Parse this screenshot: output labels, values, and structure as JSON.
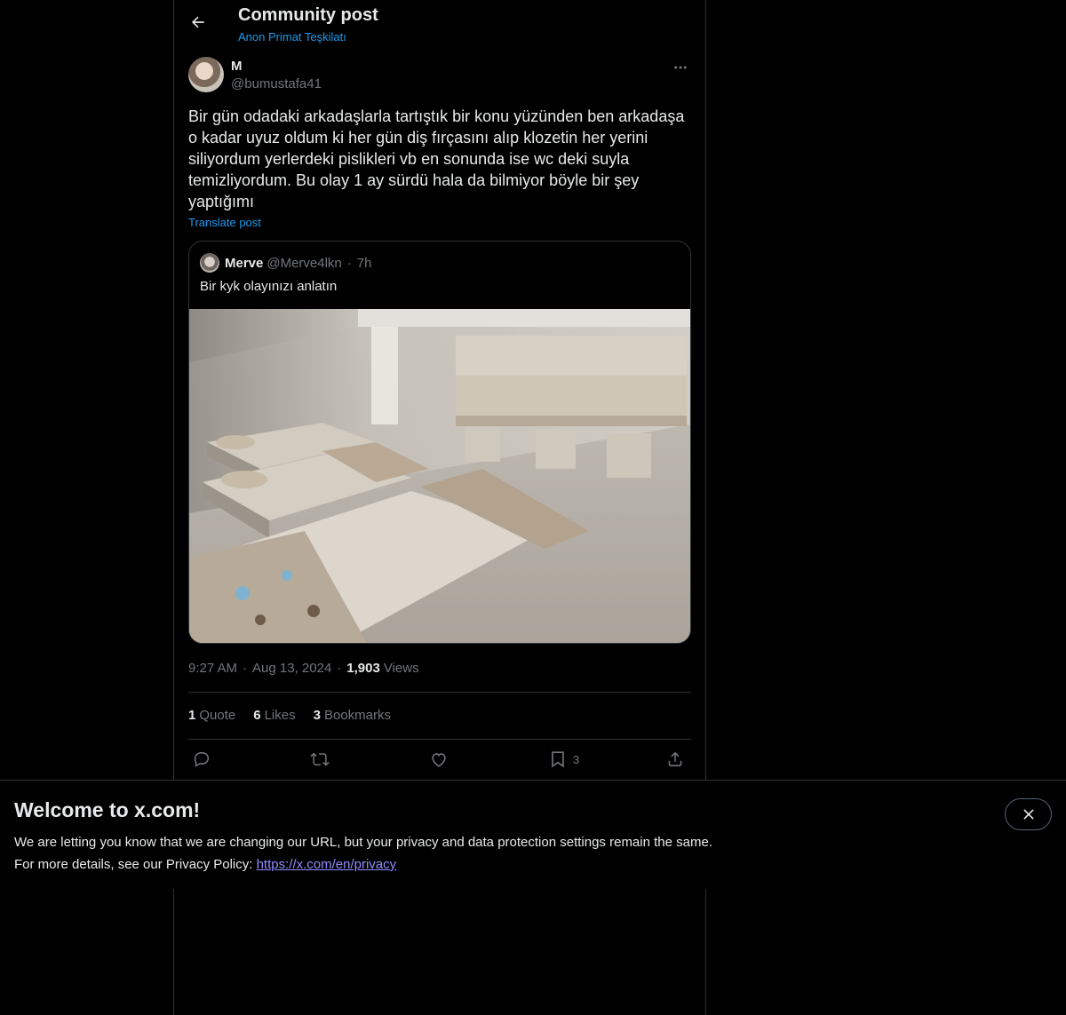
{
  "header": {
    "title": "Community post",
    "community": "Anon Primat Teşkilatı"
  },
  "post": {
    "author_name": "M",
    "author_handle": "@bumustafa41",
    "text": "Bir gün odadaki arkadaşlarla tartıştık bir konu yüzünden ben arkadaşa o kadar uyuz oldum ki her gün diş fırçasını alıp klozetin her yerini siliyordum yerlerdeki pislikleri vb en sonunda ise wc deki suyla temizliyordum. Bu olay 1 ay sürdü hala da bilmiyor böyle bir şey yaptığımı",
    "translate_label": "Translate post",
    "time": "9:27 AM",
    "date": "Aug 13, 2024",
    "views_count": "1,903",
    "views_label": "Views"
  },
  "quote": {
    "name": "Merve",
    "handle": "@Merve4lkn",
    "dot": "·",
    "time": "7h",
    "text": "Bir kyk olayınızı anlatın",
    "image_desc_icon": "dorm-room-photo"
  },
  "stats": {
    "quote_count": "1",
    "quote_label": "Quote",
    "likes_count": "6",
    "likes_label": "Likes",
    "bookmarks_count": "3",
    "bookmarks_label": "Bookmarks"
  },
  "actions": {
    "reply_icon": "reply-icon",
    "repost_icon": "repost-icon",
    "like_icon": "heart-icon",
    "bookmark_icon": "bookmark-icon",
    "bookmark_count": "3",
    "share_icon": "share-icon"
  },
  "banner": {
    "title": "Welcome to x.com!",
    "line1": "We are letting you know that we are changing our URL, but your privacy and data protection settings remain the same.",
    "line2_prefix": "For more details, see our Privacy Policy: ",
    "link_text": "https://x.com/en/privacy"
  },
  "colors": {
    "background": "#000000",
    "text": "#e7e9ea",
    "muted": "#71767b",
    "accent": "#1d9bf0",
    "border": "#2f3336",
    "link": "#8e8bff"
  }
}
